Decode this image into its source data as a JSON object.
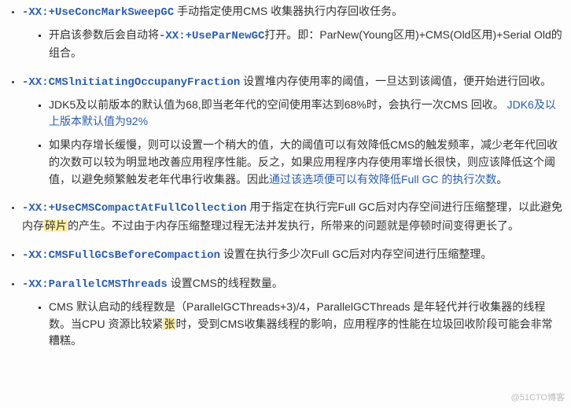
{
  "items": [
    {
      "flag": "-XX:+UseConcMarkSweepGC",
      "desc": " 手动指定使用CMS 收集器执行内存回收任务。",
      "subs": [
        {
          "pre": "开启该参数后会自动将",
          "code": "-XX:+UseParNewGC",
          "post": "打开。即：ParNew(Young区用)+CMS(Old区用)+Serial Old的组合。"
        }
      ]
    },
    {
      "flag": "-XX:CMSlnitiatingOccupanyFraction",
      "desc": " 设置堆内存使用率的阈值，一旦达到该阈值，便开始进行回收。",
      "subs": [
        {
          "text_a": "JDK5及以前版本的默认值为68,即当老年代的空间使用率达到68%时，会执行一次CMS 回收。",
          "link": "JDK6及以上版本默认值为92%"
        },
        {
          "text_a": "如果内存增长缓慢，则可以设置一个稍大的值，大的阈值可以有效降低CMS的触发频率，减少老年代回收的次数可以较为明显地改善应用程序性能。反之，如果应用程序内存使用率增长很快，则应该降低这个阈值，以避免频繁触发老年代串行收集器。因此",
          "link": "通过该选项便可以有效降低Full GC 的执行次数",
          "tail": "。"
        }
      ]
    },
    {
      "flag": "-XX:+UseCMSCompactAtFullCollection",
      "desc_a": " 用于指定在执行完Full GC后对内存空间进行压缩整理，以此避免内存",
      "hl": "碎片",
      "desc_b": "的产生。不过由于内存压缩整理过程无法并发执行，所带来的问题就是停顿时间变得更长了。"
    },
    {
      "flag": "-XX:CMSFullGCsBeforeCompaction",
      "desc": " 设置在执行多少次Full GC后对内存空间进行压缩整理。"
    },
    {
      "flag": "-XX:ParallelCMSThreads",
      "desc": " 设置CMS的线程数量。",
      "subs": [
        {
          "text_a": "CMS 默认启动的线程数是（ParallelGCThreads+3)/4，ParallelGCThreads 是年轻代并行收集器的线程数。当CPU 资源比较紧",
          "hl": "张",
          "text_b": "时，受到CMS收集器线程的影响，应用程序的性能在垃圾回收阶段可能会非常糟糕。"
        }
      ]
    }
  ],
  "watermark": "@51CTO博客"
}
